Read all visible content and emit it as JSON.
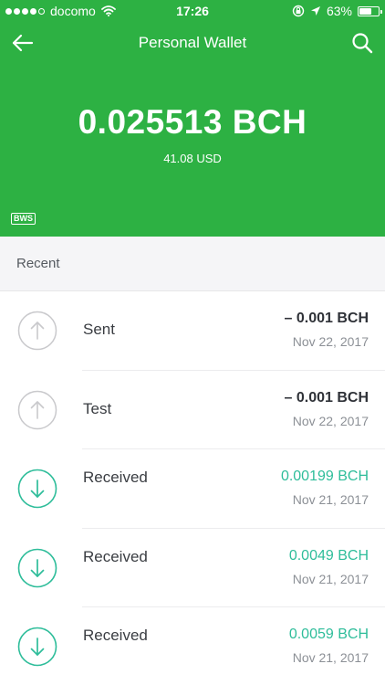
{
  "status_bar": {
    "carrier": "docomo",
    "time": "17:26",
    "battery": "63%",
    "battery_level": 0.63
  },
  "nav": {
    "title": "Personal Wallet"
  },
  "balance": {
    "main": "0.025513 BCH",
    "alternative": "41.08 USD",
    "badge": "BWS"
  },
  "section": {
    "title": "Recent"
  },
  "colors": {
    "header_bg": "#2db143",
    "received": "#2ebd9a",
    "sent_icon": "#c9c9cc"
  },
  "transactions": [
    {
      "type": "sent",
      "icon": "arrow-up-icon",
      "label": "Sent",
      "amount": "– 0.001 BCH",
      "date": "Nov 22, 2017"
    },
    {
      "type": "sent",
      "icon": "arrow-up-icon",
      "label": "Test",
      "amount": "– 0.001 BCH",
      "date": "Nov 22, 2017"
    },
    {
      "type": "received",
      "icon": "arrow-down-icon",
      "label": "Received",
      "amount": "0.00199 BCH",
      "date": "Nov 21, 2017"
    },
    {
      "type": "received",
      "icon": "arrow-down-icon",
      "label": "Received",
      "amount": "0.0049 BCH",
      "date": "Nov 21, 2017"
    },
    {
      "type": "received",
      "icon": "arrow-down-icon",
      "label": "Received",
      "amount": "0.0059 BCH",
      "date": "Nov 21, 2017"
    }
  ]
}
